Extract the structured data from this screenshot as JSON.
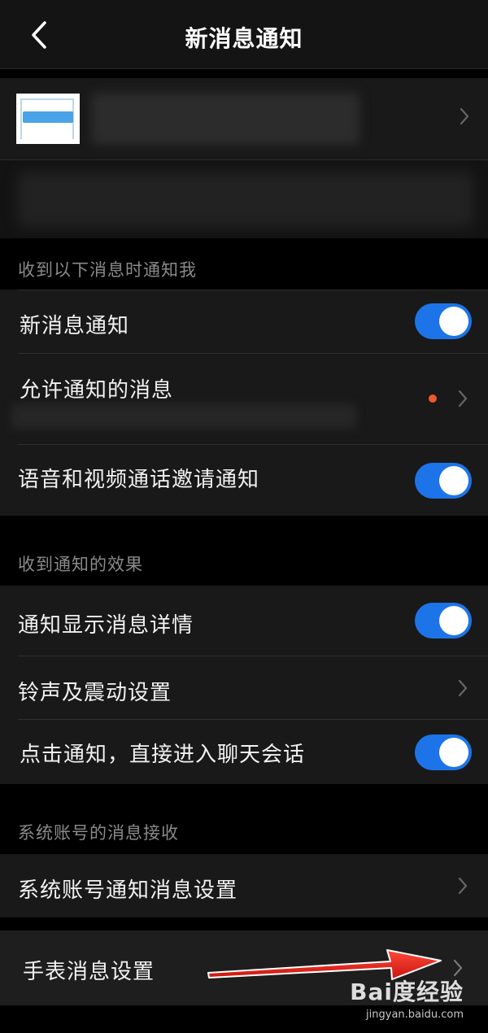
{
  "header": {
    "title": "新消息通知"
  },
  "sections": [
    {
      "label": "收到以下消息时通知我",
      "rows": [
        {
          "label": "新消息通知",
          "control": "toggle",
          "on": true
        },
        {
          "label": "允许通知的消息",
          "control": "chevron",
          "badge": "red-dot"
        },
        {
          "label": "语音和视频通话邀请通知",
          "control": "toggle",
          "on": true
        }
      ]
    },
    {
      "label": "收到通知的效果",
      "rows": [
        {
          "label": "通知显示消息详情",
          "control": "toggle",
          "on": true
        },
        {
          "label": "铃声及震动设置",
          "control": "chevron"
        },
        {
          "label": "点击通知，直接进入聊天会话",
          "control": "toggle",
          "on": true
        }
      ]
    },
    {
      "label": "系统账号的消息接收",
      "rows": [
        {
          "label": "系统账号通知消息设置",
          "control": "chevron"
        }
      ]
    }
  ],
  "watch_row": {
    "label": "手表消息设置",
    "control": "chevron"
  },
  "colors": {
    "toggle_on": "#1d74e8",
    "background": "#000000",
    "row_background": "#191919",
    "arrow": "#e8231b",
    "badge": "#f0582f"
  },
  "watermark": {
    "logo": "Bai度经验",
    "url": "jingyan.baidu.com"
  }
}
